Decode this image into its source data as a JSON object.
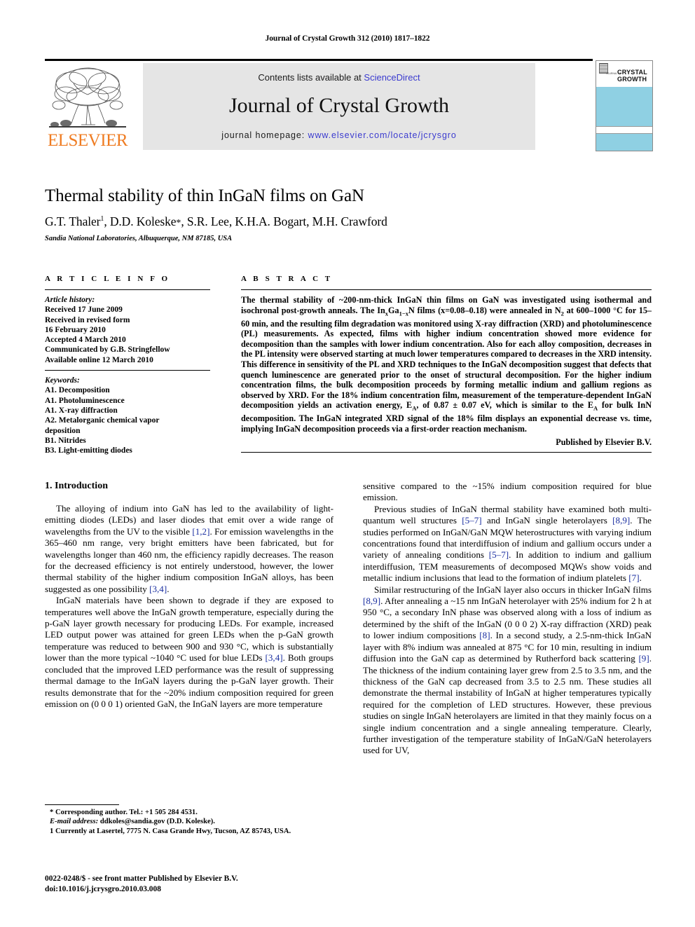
{
  "running_head": "Journal of Crystal Growth 312 (2010) 1817–1822",
  "masthead": {
    "contents_prefix": "Contents lists available at ",
    "sciencedirect": "ScienceDirect",
    "journal_name": "Journal of Crystal Growth",
    "homepage_prefix": "journal homepage: ",
    "homepage_url": "www.elsevier.com/locate/jcrysgro",
    "publisher_logo_text": "ELSEVIER",
    "link_color": "#3b3bcf",
    "publisher_color": "#ef7c22",
    "band_color": "#e5e5e5"
  },
  "cover": {
    "publisher_small": "JOURNAL OF",
    "title_line1": "CRYSTAL",
    "title_line2": "GROWTH",
    "accent_color": "#8fd0e3"
  },
  "title_block": {
    "title": "Thermal stability of thin InGaN films on GaN",
    "authors_plain": "G.T. Thaler 1, D.D. Koleske *, S.R. Lee, K.H.A. Bogart, M.H. Crawford",
    "affiliation": "Sandia National Laboratories, Albuquerque, NM 87185, USA"
  },
  "article_info": {
    "heading": "A R T I C L E   I N F O",
    "history_label": "Article history:",
    "history_lines": [
      "Received 17 June 2009",
      "Received in revised form",
      "16 February 2010",
      "Accepted 4 March 2010",
      "Communicated by G.B. Stringfellow",
      "Available online 12 March 2010"
    ],
    "keywords_label": "Keywords:",
    "keywords": [
      "A1. Decomposition",
      "A1. Photoluminescence",
      "A1. X-ray diffraction",
      "A2. Metalorganic chemical vapor",
      "deposition",
      "B1. Nitrides",
      "B3. Light-emitting diodes"
    ]
  },
  "abstract": {
    "heading": "A B S T R A C T",
    "text_part1": "The thermal stability of ~200-nm-thick InGaN thin films on GaN was investigated using isothermal and isochronal post-growth anneals. The In",
    "sub_x1": "x",
    "text_part2": "Ga",
    "sub_1x": "1−x",
    "text_part3": "N films (x=0.08–0.18) were annealed in N",
    "sub_2": "2",
    "text_part4": " at 600–1000 °C for 15–60 min, and the resulting film degradation was monitored using X-ray diffraction (XRD) and photoluminescence (PL) measurements. As expected, films with higher indium concentration showed more evidence for decomposition than the samples with lower indium concentration. Also for each alloy composition, decreases in the PL intensity were observed starting at much lower temperatures compared to decreases in the XRD intensity. This difference in sensitivity of the PL and XRD techniques to the InGaN decomposition suggest that defects that quench luminescence are generated prior to the onset of structural decomposition. For the higher indium concentration films, the bulk decomposition proceeds by forming metallic indium and gallium regions as observed by XRD. For the 18% indium concentration film, measurement of the temperature-dependent InGaN decomposition yields an activation energy, E",
    "sub_A1": "A",
    "text_part5": ", of 0.87 ± 0.07 eV, which is similar to the E",
    "sub_A2": "A",
    "text_part6": " for bulk InN decomposition. The InGaN integrated XRD signal of the 18% film displays an exponential decrease vs. time, implying InGaN decomposition proceeds via a first-order reaction mechanism.",
    "published_by": "Published by Elsevier B.V."
  },
  "body": {
    "section_heading": "1. Introduction",
    "left_paragraphs": [
      {
        "pre": "The alloying of indium into GaN has led to the availability of light-emitting diodes (LEDs) and laser diodes that emit over a wide range of wavelengths from the UV to the visible ",
        "ref1": "[1,2]",
        "mid": ". For emission wavelengths in the 365–460 nm range, very bright emitters have been fabricated, but for wavelengths longer than 460 nm, the efficiency rapidly decreases. The reason for the decreased efficiency is not entirely understood, however, the lower thermal stability of the higher indium composition InGaN alloys, has been suggested as one possibility ",
        "ref2": "[3,4]",
        "post": "."
      },
      {
        "pre": "InGaN materials have been shown to degrade if they are exposed to temperatures well above the InGaN growth temperature, especially during the p-GaN layer growth necessary for producing LEDs. For example, increased LED output power was attained for green LEDs when the p-GaN growth temperature was reduced to between 900 and 930 °C, which is substantially lower than the more typical ~1040 °C used for blue LEDs ",
        "ref1": "[3,4]",
        "mid": ". Both groups concluded that the improved LED performance was the result of suppressing thermal damage to the InGaN layers during the p-GaN layer growth. Their results demonstrate that for the ~20% indium composition required for green emission on (0 0 0 1) oriented GaN, the InGaN layers are more temperature",
        "ref2": "",
        "post": ""
      }
    ],
    "right_paragraphs": [
      {
        "pre": "sensitive compared to the ~15% indium composition required for blue emission.",
        "ref1": "",
        "mid": "",
        "ref2": "",
        "post": ""
      },
      {
        "pre": "Previous studies of InGaN thermal stability have examined both multi-quantum well structures ",
        "ref1": "[5–7]",
        "mid": " and InGaN single heterolayers ",
        "ref2": "[8,9]",
        "post": ". The studies performed on InGaN/GaN MQW heterostructures with varying indium concentrations found that interdiffusion of indium and gallium occurs under a variety of annealing conditions ",
        "ref3": "[5–7]",
        "post2": ". In addition to indium and gallium interdiffusion, TEM measurements of decomposed MQWs show voids and metallic indium inclusions that lead to the formation of indium platelets ",
        "ref4": "[7]",
        "post3": "."
      },
      {
        "pre": "Similar restructuring of the InGaN layer also occurs in thicker InGaN films ",
        "ref1": "[8,9]",
        "mid": ". After annealing a ~15 nm InGaN heterolayer with 25% indium for 2 h at 950 °C, a secondary InN phase was observed along with a loss of indium as determined by the shift of the InGaN (0 0 0 2) X-ray diffraction (XRD) peak to lower indium compositions ",
        "ref2": "[8]",
        "post": ". In a second study, a 2.5-nm-thick InGaN layer with 8% indium was annealed at 875 °C for 10 min, resulting in indium diffusion into the GaN cap as determined by Rutherford back scattering ",
        "ref3": "[9]",
        "post2": ". The thickness of the indium containing layer grew from 2.5 to 3.5 nm, and the thickness of the GaN cap decreased from 3.5 to 2.5 nm. These studies all demonstrate the thermal instability of InGaN at higher temperatures typically required for the completion of LED structures. However, these previous studies on single InGaN heterolayers are limited in that they mainly focus on a single indium concentration and a single annealing temperature. Clearly, further investigation of the temperature stability of InGaN/GaN heterolayers used for UV,"
      }
    ]
  },
  "footnotes": {
    "corresponding": "* Corresponding author. Tel.: +1 505 284 4531.",
    "email_label": "E-mail address:",
    "email_value": "ddkoles@sandia.gov (D.D. Koleske).",
    "affil_note": "1 Currently at Lasertel, 7775 N. Casa Grande Hwy, Tucson, AZ 85743, USA."
  },
  "issn": {
    "line1": "0022-0248/$ - see front matter Published by Elsevier B.V.",
    "line2": "doi:10.1016/j.jcrysgro.2010.03.008"
  }
}
